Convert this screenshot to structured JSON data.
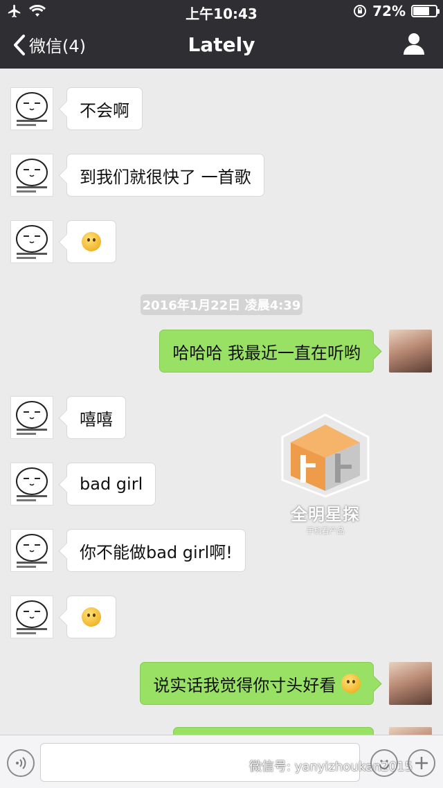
{
  "status_bar": {
    "time": "上午10:43",
    "battery": "72%",
    "battery_level": 0.72
  },
  "nav": {
    "back_label": "微信(4)",
    "title": "Lately"
  },
  "messages": [
    {
      "side": "in",
      "text": "不会啊"
    },
    {
      "side": "in",
      "text": "到我们就很快了 一首歌"
    },
    {
      "side": "in",
      "text": "",
      "emoji": "thinking-emoji"
    },
    {
      "side": "out",
      "text": "哈哈哈 我最近一直在听哟"
    },
    {
      "side": "in",
      "text": "嘻嘻"
    },
    {
      "side": "in",
      "text": "bad girl"
    },
    {
      "side": "in",
      "text": "你不能做bad girl啊!"
    },
    {
      "side": "in",
      "text": "",
      "emoji": "blush-emoji"
    },
    {
      "side": "out",
      "text": "说实话我觉得你寸头好看",
      "emoji": "tongue-wink-emoji"
    }
  ],
  "timestamp": "2016年1月22日 凌晨4:39",
  "watermark": {
    "title": "全明星探",
    "subtitle": "手机看产品"
  },
  "footer_mark": "微信号: yanyizhoukan2015",
  "colors": {
    "header_bg": "#2f2f33",
    "chat_bg": "#ebebeb",
    "outgoing_bubble": "#98e165",
    "incoming_bubble": "#ffffff"
  }
}
